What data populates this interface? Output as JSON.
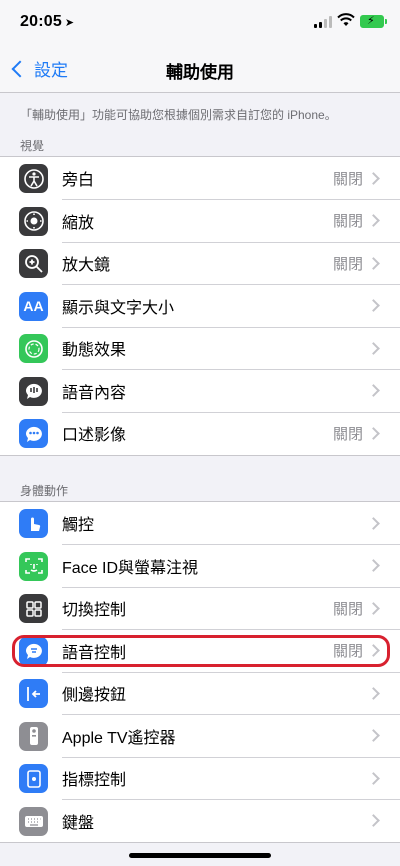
{
  "status": {
    "time": "20:05"
  },
  "nav": {
    "back_label": "設定",
    "title": "輔助使用"
  },
  "description": "「輔助使用」功能可協助您根據個別需求自訂您的 iPhone。",
  "sections": [
    {
      "header": "視覺",
      "items": [
        {
          "label": "旁白",
          "value": "關閉",
          "icon": "voiceover-icon",
          "color": "#3a3a3c"
        },
        {
          "label": "縮放",
          "value": "關閉",
          "icon": "zoom-icon",
          "color": "#3a3a3c"
        },
        {
          "label": "放大鏡",
          "value": "關閉",
          "icon": "magnifier-icon",
          "color": "#3a3a3c"
        },
        {
          "label": "顯示與文字大小",
          "value": "",
          "icon": "text-size-icon",
          "color": "#2f7cf6"
        },
        {
          "label": "動態效果",
          "value": "",
          "icon": "motion-icon",
          "color": "#34c759"
        },
        {
          "label": "語音內容",
          "value": "",
          "icon": "spoken-content-icon",
          "color": "#3a3a3c"
        },
        {
          "label": "口述影像",
          "value": "關閉",
          "icon": "audio-descriptions-icon",
          "color": "#2f7cf6"
        }
      ]
    },
    {
      "header": "身體動作",
      "items": [
        {
          "label": "觸控",
          "value": "",
          "icon": "touch-icon",
          "color": "#2f7cf6"
        },
        {
          "label": "Face ID與螢幕注視",
          "value": "",
          "icon": "faceid-icon",
          "color": "#34c759"
        },
        {
          "label": "切換控制",
          "value": "關閉",
          "icon": "switch-control-icon",
          "color": "#3a3a3c"
        },
        {
          "label": "語音控制",
          "value": "關閉",
          "icon": "voice-control-icon",
          "color": "#2f7cf6"
        },
        {
          "label": "側邊按鈕",
          "value": "",
          "icon": "side-button-icon",
          "color": "#2f7cf6"
        },
        {
          "label": "Apple TV遙控器",
          "value": "",
          "icon": "apple-tv-remote-icon",
          "color": "#8e8e93"
        },
        {
          "label": "指標控制",
          "value": "",
          "icon": "pointer-control-icon",
          "color": "#2f7cf6"
        },
        {
          "label": "鍵盤",
          "value": "",
          "icon": "keyboard-icon",
          "color": "#8e8e93"
        }
      ]
    }
  ]
}
